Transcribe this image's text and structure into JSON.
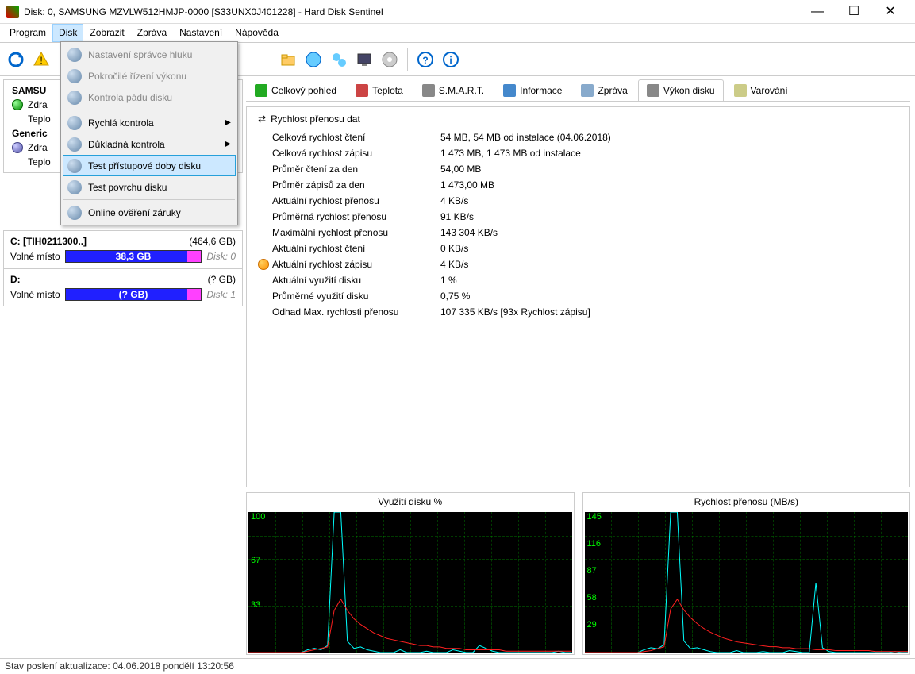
{
  "window": {
    "title": "Disk: 0, SAMSUNG MZVLW512HMJP-0000 [S33UNX0J401228]  -  Hard Disk Sentinel"
  },
  "menu": {
    "items": [
      "Program",
      "Disk",
      "Zobrazit",
      "Zpráva",
      "Nastavení",
      "Nápověda"
    ],
    "open_index": 1,
    "dropdown": [
      {
        "label": "Nastavení správce hluku",
        "disabled": true
      },
      {
        "label": "Pokročilé řízení výkonu",
        "disabled": true
      },
      {
        "label": "Kontrola pádu disku",
        "disabled": true
      },
      {
        "sep": true
      },
      {
        "label": "Rychlá kontrola",
        "submenu": true
      },
      {
        "label": "Důkladná kontrola",
        "submenu": true
      },
      {
        "label": "Test přístupové doby disku",
        "selected": true
      },
      {
        "label": "Test povrchu disku"
      },
      {
        "sep": true
      },
      {
        "label": "Online ověření záruky"
      }
    ]
  },
  "sidebar": {
    "disks": [
      {
        "name": "SAMSU",
        "rows": [
          {
            "label": "Zdra",
            "icon": "ok"
          },
          {
            "label": "Teplo",
            "icon": "none"
          }
        ]
      },
      {
        "name": "Generic",
        "rows": [
          {
            "label": "Zdra",
            "icon": "q"
          },
          {
            "label": "Teplo",
            "icon": "none"
          }
        ]
      }
    ],
    "volumes": [
      {
        "name": "C: [TIH0211300..]",
        "size": "(464,6 GB)",
        "free_label": "Volné místo",
        "free": "38,3 GB",
        "disk": "Disk: 0"
      },
      {
        "name": "D:",
        "size": "(? GB)",
        "free_label": "Volné místo",
        "free": "(? GB)",
        "disk": "Disk: 1"
      }
    ]
  },
  "tabs": [
    {
      "label": "Celkový pohled",
      "icon": "#2a2"
    },
    {
      "label": "Teplota",
      "icon": "#c44"
    },
    {
      "label": "S.M.A.R.T.",
      "icon": "#888"
    },
    {
      "label": "Informace",
      "icon": "#48c"
    },
    {
      "label": "Zpráva",
      "icon": "#8ac"
    },
    {
      "label": "Výkon disku",
      "icon": "#888",
      "active": true
    },
    {
      "label": "Varování",
      "icon": "#cc8"
    }
  ],
  "panel": {
    "title": "Rychlost přenosu dat",
    "rows": [
      {
        "k": "Celková rychlost čtení",
        "v": "54 MB,  54 MB od instalace  (04.06.2018)"
      },
      {
        "k": "Celková rychlost zápisu",
        "v": "1 473 MB,  1 473 MB od instalace"
      },
      {
        "k": "Průměr čtení za den",
        "v": "54,00 MB"
      },
      {
        "k": "Průměr zápisů za den",
        "v": "1 473,00 MB"
      },
      {
        "k": "Aktuální rychlost přenosu",
        "v": "4 KB/s"
      },
      {
        "k": "Průměrná rychlost přenosu",
        "v": "91 KB/s"
      },
      {
        "k": "Maximální rychlost přenosu",
        "v": "143 304 KB/s"
      },
      {
        "k": "Aktuální rychlost čtení",
        "v": "0 KB/s"
      },
      {
        "k": "Aktuální rychlost zápisu",
        "v": "4 KB/s",
        "marker": true
      },
      {
        "k": "Aktuální využití disku",
        "v": "1 %"
      },
      {
        "k": "Průměrné využití disku",
        "v": "0,75 %"
      },
      {
        "k": "Odhad Max. rychlosti přenosu",
        "v": "107 335 KB/s [93x Rychlost zápisu]"
      }
    ]
  },
  "chart_data": [
    {
      "type": "line",
      "title": "Využití disku %",
      "ylim": [
        0,
        100
      ],
      "yticks": [
        "100",
        "67",
        "33"
      ],
      "series": [
        {
          "name": "cyan",
          "color": "#00ffff",
          "values": [
            0,
            0,
            0,
            0,
            0,
            0,
            0,
            0,
            0,
            2,
            3,
            2,
            5,
            100,
            100,
            8,
            3,
            4,
            2,
            1,
            0,
            0,
            0,
            2,
            0,
            0,
            0,
            1,
            0,
            0,
            0,
            2,
            1,
            0,
            0,
            5,
            3,
            1,
            0,
            0,
            0,
            0,
            0,
            0,
            0,
            0,
            0,
            1,
            0,
            0
          ]
        },
        {
          "name": "red",
          "color": "#ff2020",
          "values": [
            0,
            0,
            0,
            0,
            0,
            0,
            0,
            0,
            0,
            1,
            2,
            3,
            4,
            30,
            38,
            30,
            24,
            20,
            17,
            14,
            12,
            10,
            9,
            8,
            7,
            6,
            5,
            5,
            4,
            4,
            3,
            3,
            3,
            2,
            2,
            2,
            2,
            2,
            2,
            1,
            1,
            1,
            1,
            1,
            1,
            1,
            1,
            1,
            1,
            1
          ]
        }
      ]
    },
    {
      "type": "line",
      "title": "Rychlost přenosu (MB/s)",
      "ylim": [
        0,
        145
      ],
      "yticks": [
        "145",
        "116",
        "87",
        "58",
        "29"
      ],
      "series": [
        {
          "name": "cyan",
          "color": "#00ffff",
          "values": [
            0,
            0,
            0,
            0,
            0,
            0,
            0,
            0,
            0,
            3,
            5,
            4,
            8,
            145,
            145,
            12,
            4,
            5,
            3,
            1,
            0,
            0,
            0,
            2,
            0,
            0,
            0,
            1,
            0,
            0,
            0,
            2,
            1,
            0,
            0,
            72,
            5,
            1,
            0,
            0,
            0,
            0,
            0,
            0,
            0,
            0,
            0,
            1,
            0,
            0
          ]
        },
        {
          "name": "red",
          "color": "#ff2020",
          "values": [
            0,
            0,
            0,
            0,
            0,
            0,
            0,
            0,
            0,
            1,
            2,
            4,
            6,
            45,
            55,
            44,
            36,
            30,
            25,
            21,
            18,
            15,
            13,
            11,
            10,
            9,
            8,
            7,
            6,
            6,
            5,
            5,
            4,
            4,
            4,
            3,
            3,
            3,
            2,
            2,
            2,
            2,
            2,
            2,
            1,
            1,
            1,
            1,
            1,
            1
          ]
        }
      ]
    }
  ],
  "status": "Stav poslení aktualizace: 04.06.2018 pondělí 13:20:56"
}
